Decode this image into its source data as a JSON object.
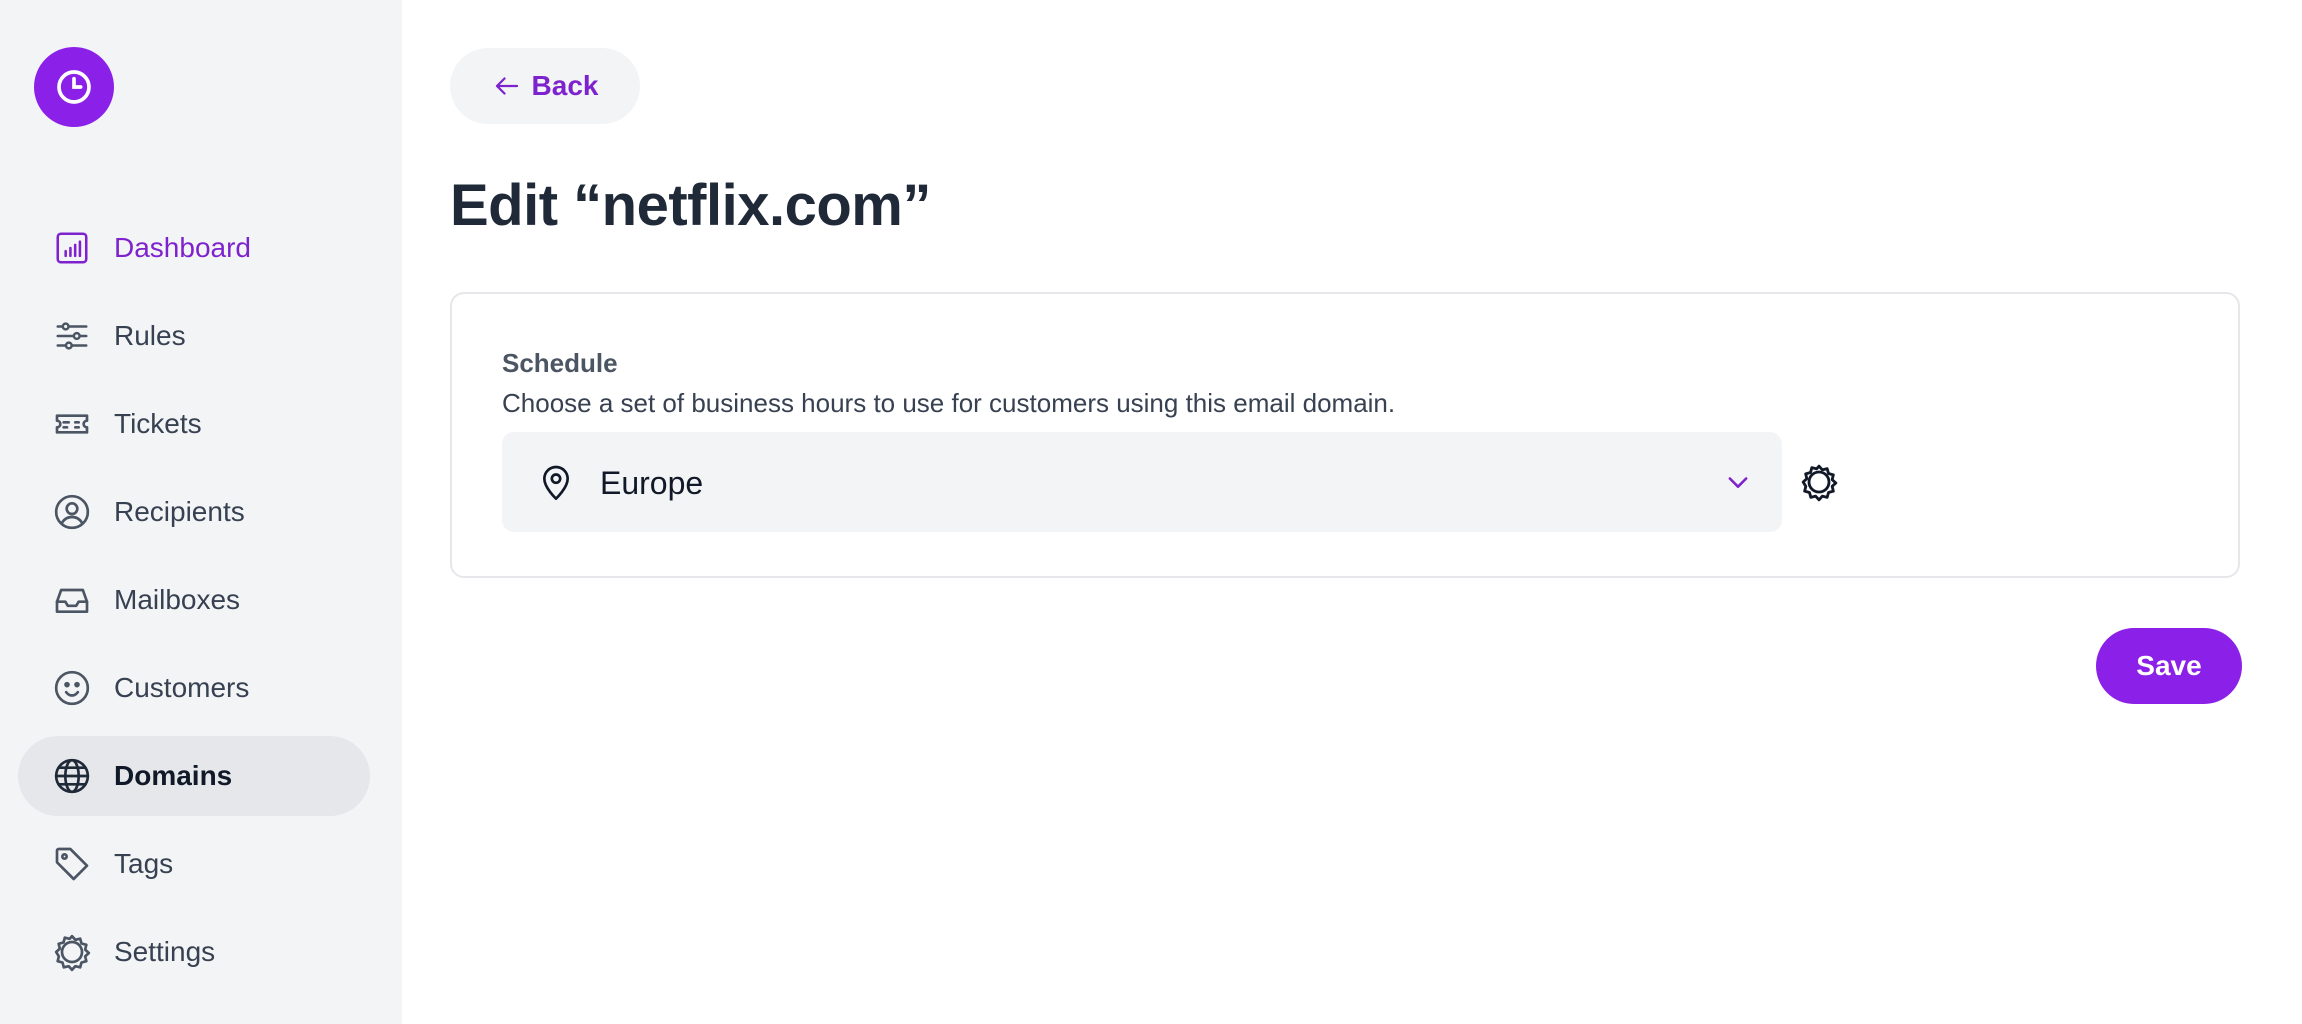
{
  "app": {
    "accent": "#8b21e8",
    "logo_icon": "clock-icon"
  },
  "sidebar": {
    "items": [
      {
        "label": "Dashboard",
        "icon": "chart-icon"
      },
      {
        "label": "Rules",
        "icon": "sliders-icon"
      },
      {
        "label": "Tickets",
        "icon": "ticket-icon"
      },
      {
        "label": "Recipients",
        "icon": "user-circle-icon"
      },
      {
        "label": "Mailboxes",
        "icon": "inbox-icon"
      },
      {
        "label": "Customers",
        "icon": "smiley-icon"
      },
      {
        "label": "Domains",
        "icon": "globe-icon",
        "active": true
      },
      {
        "label": "Tags",
        "icon": "tag-icon"
      },
      {
        "label": "Settings",
        "icon": "gear-icon"
      }
    ]
  },
  "main": {
    "back_label": "Back",
    "title": "Edit “netflix.com”",
    "schedule": {
      "heading": "Schedule",
      "description": "Choose a set of business hours to use for customers using this email domain.",
      "selected": "Europe"
    },
    "save_label": "Save"
  }
}
